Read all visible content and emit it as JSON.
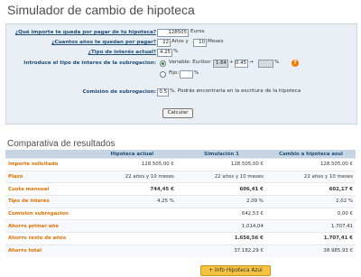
{
  "page": {
    "title": "Simulador de cambio de hipoteca",
    "section_title": "Comparativa de resultados"
  },
  "form": {
    "q_owed": "¿Qué importe te queda por pagar de tu hipoteca?",
    "owed_value": "128505",
    "owed_unit": "Euros",
    "q_years": "¿Cuantos años te quedan por pagar?",
    "years_value": "22",
    "years_unit": "Años y",
    "months_value": "10",
    "months_unit": "Meses",
    "q_rate": "¿Tipo de interés actual?",
    "rate_value": "4.25",
    "rate_unit": "%",
    "q_subrogation": "Introduce el tipo de interes de la subrogacion:",
    "variable_label": "Variable: Euribor",
    "euribor_value": "1.64",
    "plus": "+",
    "spread_value": "0.45",
    "arrow": "→",
    "result_rate": "",
    "result_unit": "%",
    "help": "?",
    "fixed_label": "Fijo:",
    "fixed_value": "",
    "fixed_unit": "%",
    "commission_label": "Comisión de subrogacion:",
    "commission_value": "0.5",
    "commission_note": "%. Podrás encontrarla en la escritura de la hipoteca",
    "calc_button": "Calcular"
  },
  "table": {
    "headers": [
      "",
      "Hipoteca actual",
      "Simulación 1",
      "Cambio a hipoteca azul"
    ],
    "rows": [
      {
        "label": "Importe solicitado",
        "c1": "128.505,00 €",
        "c2": "128.505,00 €",
        "c3": "128.505,00 €",
        "bold": false
      },
      {
        "label": "Plazo",
        "c1": "22 años y 10 meses",
        "c2": "22 años y 10 meses",
        "c3": "22 años y 10 meses",
        "bold": false
      },
      {
        "label": "Cuota mensual",
        "c1": "744,45 €",
        "c2": "606,41 €",
        "c3": "602,17 €",
        "bold": true
      },
      {
        "label": "Tipo de interés",
        "c1": "4,25 %",
        "c2": "2,09 %",
        "c3": "2,02 %",
        "bold": false
      },
      {
        "label": "Comision subrogacion",
        "c1": "",
        "c2": "642,53 €",
        "c3": "0,00 €",
        "bold": false
      },
      {
        "label": "Ahorro primer año",
        "c1": "",
        "c2": "1.014,04",
        "c3": "1.707,41",
        "bold": false
      },
      {
        "label": "Ahorro resto de años",
        "c1": "",
        "c2": "1.656,56 €",
        "c3": "1.707,41 €",
        "bold": true
      },
      {
        "label": "Ahorro total",
        "c1": "",
        "c2": "37.182,29 €",
        "c3": "38.985,93 €",
        "bold": false
      }
    ]
  },
  "info_button": "+ Info Hipoteca Azul"
}
